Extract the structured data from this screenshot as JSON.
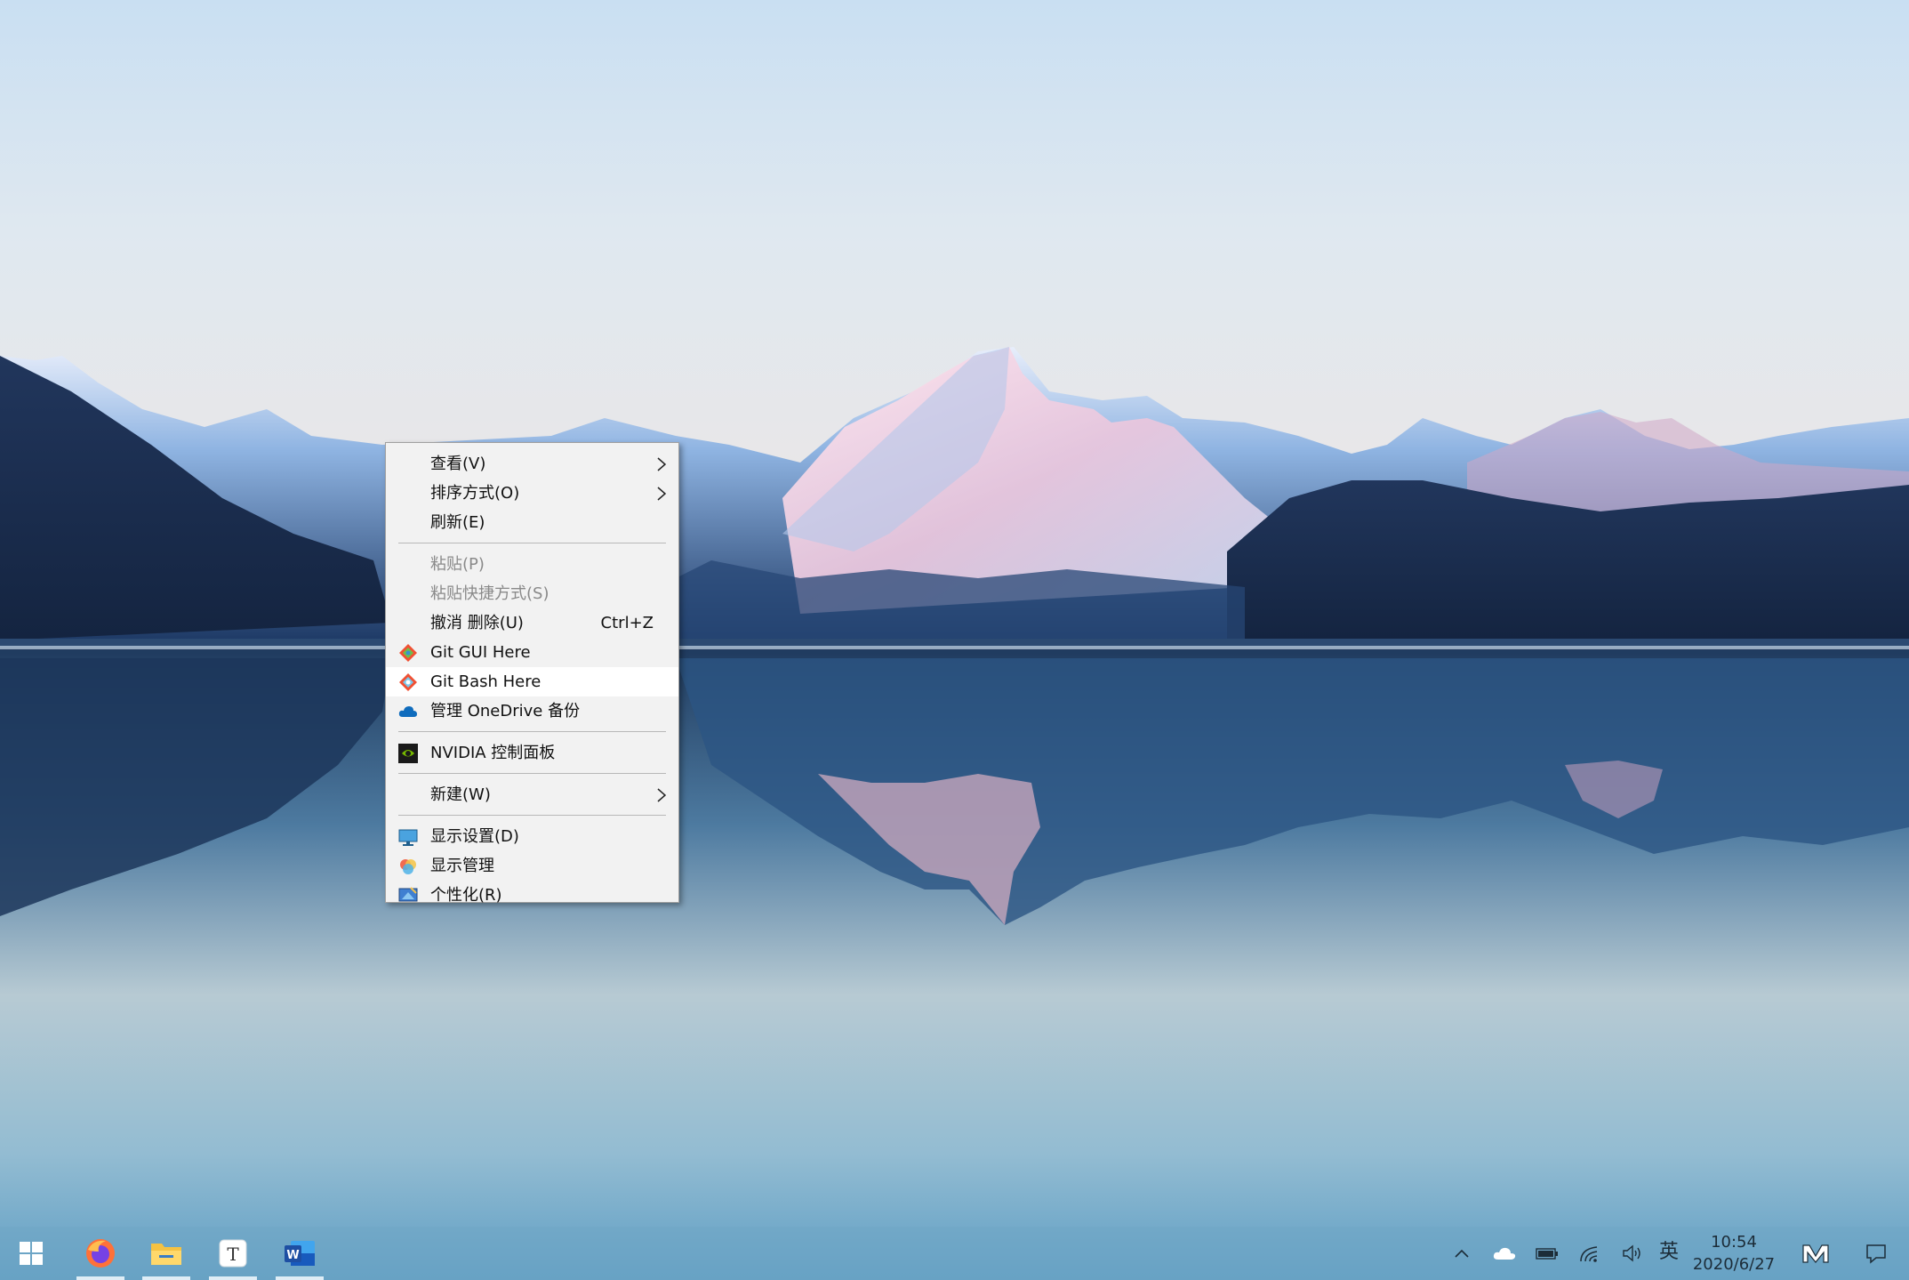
{
  "desktop": {
    "theme": "mountain-lake-wallpaper"
  },
  "context_menu": {
    "items": [
      {
        "label": "查看(V)",
        "submenu": true
      },
      {
        "label": "排序方式(O)",
        "submenu": true
      },
      {
        "label": "刷新(E)"
      },
      {
        "separator": true
      },
      {
        "label": "粘贴(P)",
        "disabled": true
      },
      {
        "label": "粘贴快捷方式(S)",
        "disabled": true
      },
      {
        "label": "撤消 删除(U)",
        "shortcut": "Ctrl+Z"
      },
      {
        "label": "Git GUI Here",
        "icon": "git-gui-icon"
      },
      {
        "label": "Git Bash Here",
        "icon": "git-bash-icon",
        "highlighted": true
      },
      {
        "label": "管理 OneDrive 备份",
        "icon": "onedrive-cloud-icon"
      },
      {
        "separator": true
      },
      {
        "label": "NVIDIA 控制面板",
        "icon": "nvidia-icon"
      },
      {
        "separator": true
      },
      {
        "label": "新建(W)",
        "submenu": true
      },
      {
        "separator": true
      },
      {
        "label": "显示设置(D)",
        "icon": "display-settings-icon"
      },
      {
        "label": "显示管理",
        "icon": "display-manager-icon"
      },
      {
        "label": "个性化(R)",
        "icon": "personalize-icon"
      }
    ]
  },
  "taskbar": {
    "apps": [
      {
        "name": "start",
        "icon": "windows-start-icon"
      },
      {
        "name": "firefox",
        "icon": "firefox-icon",
        "running": true
      },
      {
        "name": "file-explorer",
        "icon": "folder-icon",
        "running": true
      },
      {
        "name": "typora",
        "icon": "typora-icon",
        "running": true
      },
      {
        "name": "word",
        "icon": "word-icon",
        "running": true
      }
    ],
    "tray": {
      "icons": [
        "chevron-up-icon",
        "onedrive-icon",
        "battery-icon",
        "wifi-icon",
        "volume-icon"
      ],
      "ime": "英",
      "time": "10:54",
      "date": "2020/6/27",
      "extra_icon": "m-logo-icon",
      "notification_icon": "action-center-icon"
    }
  }
}
